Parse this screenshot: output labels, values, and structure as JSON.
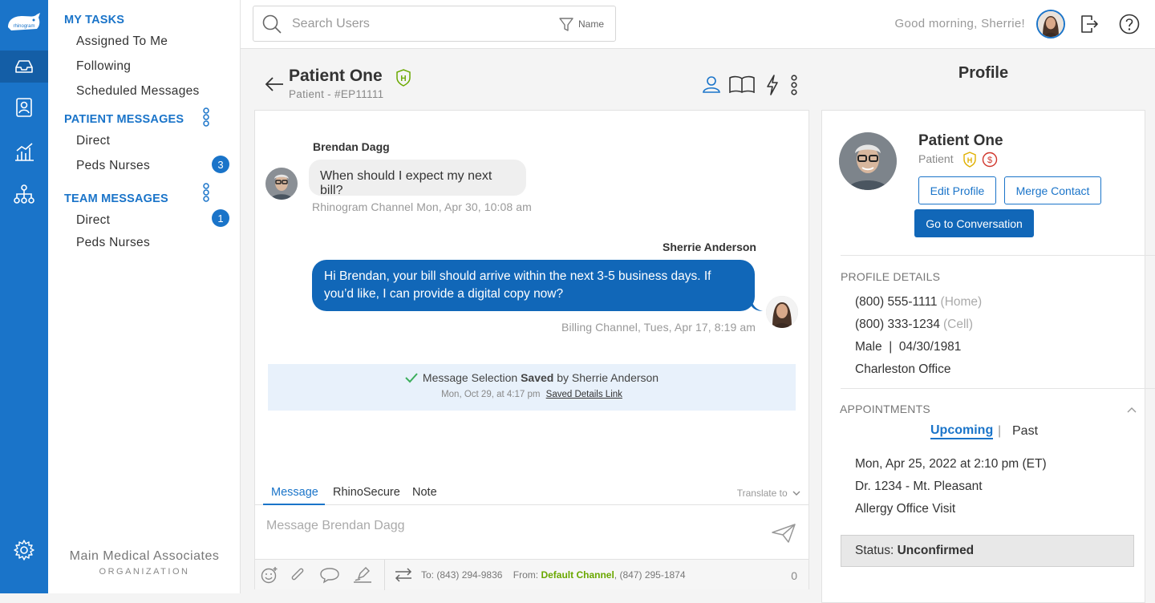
{
  "brand": {
    "name": "rhinogram",
    "accent": "#1a74c9",
    "accent_dark": "#1167b8",
    "success": "#6aa800"
  },
  "rail": {
    "items": [
      {
        "name": "inbox-icon",
        "active": true
      },
      {
        "name": "contacts-icon",
        "active": false
      },
      {
        "name": "analytics-icon",
        "active": false
      },
      {
        "name": "org-chart-icon",
        "active": false
      }
    ],
    "settings_icon": "gear-icon"
  },
  "sidebar": {
    "my_tasks": {
      "header": "MY TASKS",
      "items": [
        "Assigned To Me",
        "Following",
        "Scheduled Messages"
      ]
    },
    "patient_messages": {
      "header": "PATIENT MESSAGES",
      "items": [
        {
          "label": "Direct",
          "badge": ""
        },
        {
          "label": "Peds Nurses",
          "badge": "3"
        }
      ]
    },
    "team_messages": {
      "header": "TEAM MESSAGES",
      "items": [
        {
          "label": "Direct",
          "badge": "1"
        },
        {
          "label": "Peds Nurses",
          "badge": ""
        }
      ]
    },
    "org": {
      "name": "Main Medical Associates",
      "subtitle": "ORGANIZATION"
    }
  },
  "topbar": {
    "search": {
      "placeholder": "Search Users",
      "value": "",
      "filter_label": "Name"
    },
    "greeting": "Good morning, Sherrie!"
  },
  "conversation": {
    "title": "Patient One",
    "subtitle": "Patient - #EP11111",
    "badge": "H",
    "messages": [
      {
        "direction": "in",
        "sender": "Brendan Dagg",
        "text": "When should I expect my next bill?",
        "meta": "Rhinogram Channel Mon, Apr 30, 10:08 am"
      },
      {
        "direction": "out",
        "sender": "Sherrie Anderson",
        "text": "Hi Brendan, your bill should arrive within the next 3-5 business days. If you’d like, I can provide a digital copy now?",
        "meta": "Billing Channel, Tues, Apr 17, 8:19 am"
      }
    ],
    "saved_notice": {
      "prefix": "Message Selection",
      "strong": "Saved",
      "suffix": "by Sherrie Anderson",
      "time": "Mon, Oct 29, at 4:17 pm",
      "link": "Saved Details Link"
    },
    "composer": {
      "tabs": [
        "Message",
        "RhinoSecure",
        "Note"
      ],
      "active_tab": "Message",
      "translate_label": "Translate to",
      "placeholder": "Message Brendan Dagg",
      "value": "",
      "to_label": "To:",
      "to_number": "(843) 294-9836",
      "from_label": "From:",
      "from_channel": "Default Channel",
      "from_number": ", (847) 295-1874",
      "char_count": "0"
    }
  },
  "profile": {
    "panel_title": "Profile",
    "name": "Patient One",
    "role": "Patient",
    "badges": [
      "H",
      "$"
    ],
    "buttons": {
      "edit": "Edit Profile",
      "merge": "Merge Contact",
      "go": "Go to Conversation"
    },
    "details_header": "PROFILE DETAILS",
    "phones": [
      {
        "number": "(800) 555-1111",
        "type": "(Home)"
      },
      {
        "number": "(800) 333-1234",
        "type": "(Cell)"
      }
    ],
    "demographics": "Male  |  04/30/1981",
    "office": "Charleston Office",
    "appointments": {
      "header": "APPOINTMENTS",
      "tabs": [
        "Upcoming",
        "Past"
      ],
      "separator": "|",
      "active_tab": "Upcoming",
      "date": "Mon, Apr 25, 2022 at 2:10 pm (ET)",
      "doctor": "Dr. 1234 - Mt. Pleasant",
      "type": "Allergy Office Visit",
      "status_label": "Status:",
      "status_value": "Unconfirmed"
    }
  }
}
